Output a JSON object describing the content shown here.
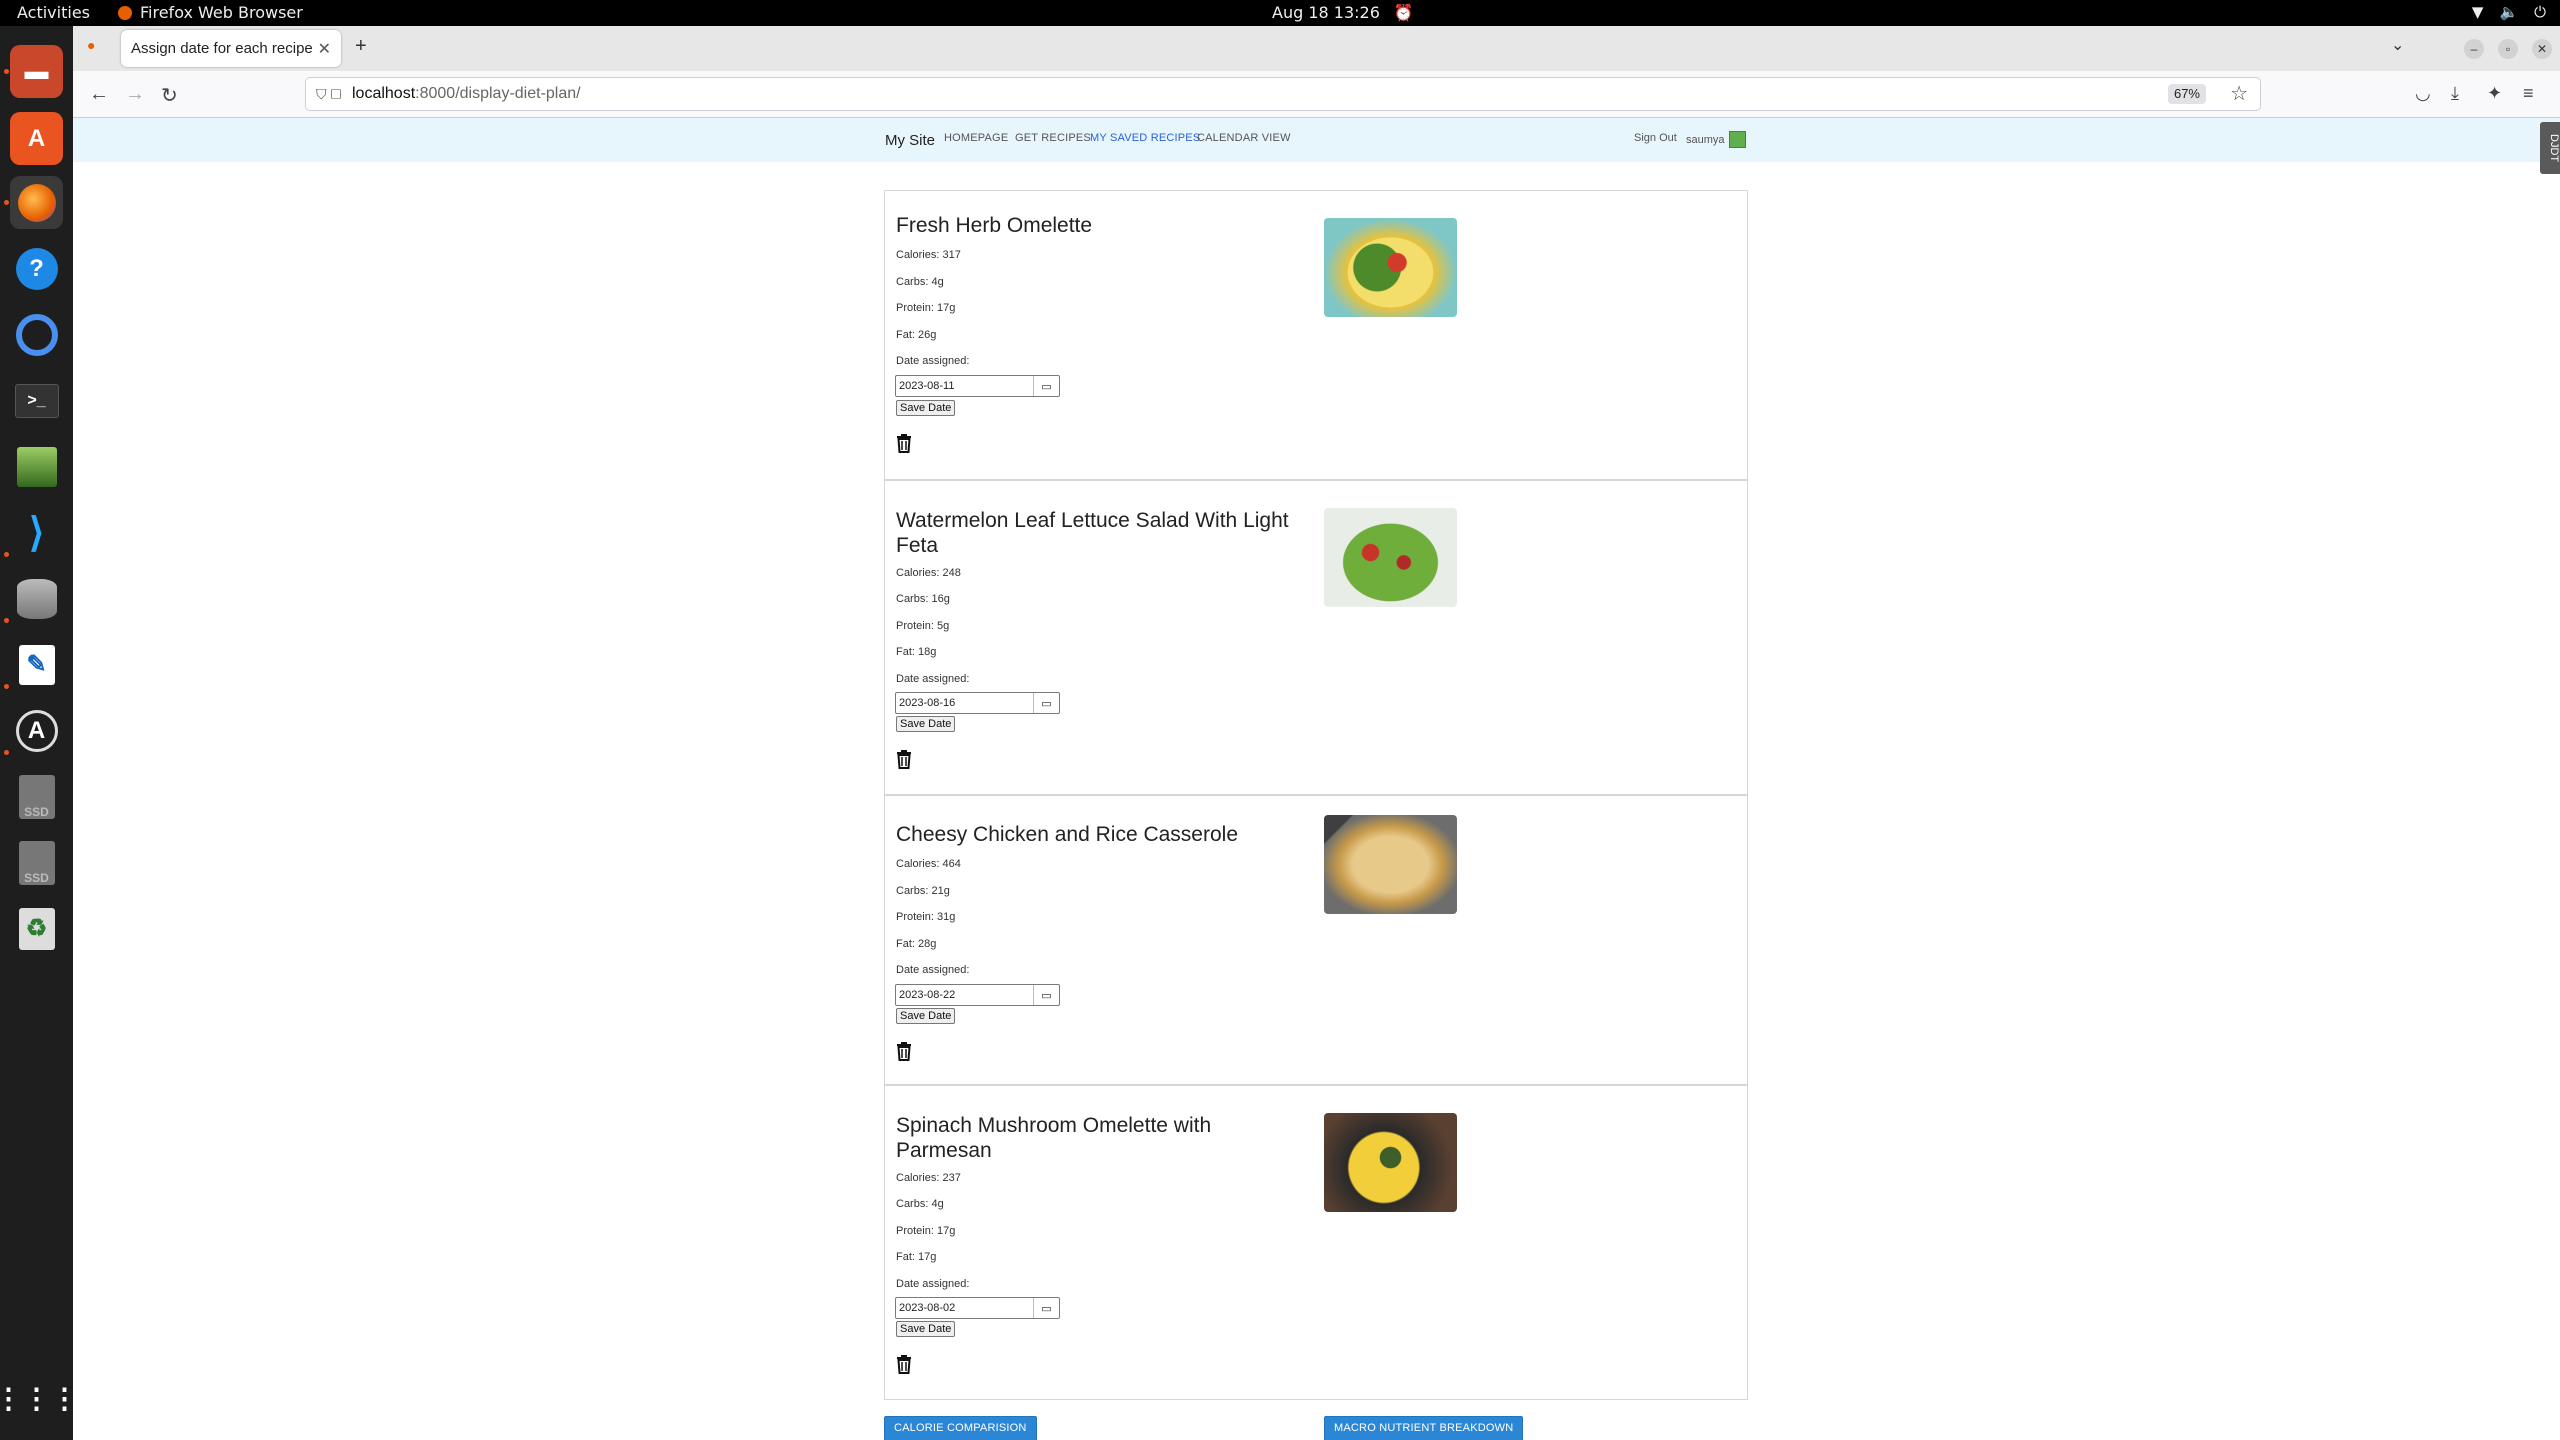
{
  "system": {
    "activities": "Activities",
    "app_name": "Firefox Web Browser",
    "clock": "Aug 18  13:26"
  },
  "browser": {
    "tab_title": "Assign date for each recipe",
    "url_host": "localhost",
    "url_path": ":8000/display-diet-plan/",
    "zoom": "67%"
  },
  "site": {
    "brand": "My Site",
    "nav": [
      "HOMEPAGE",
      "GET RECIPES",
      "MY SAVED RECIPES",
      "CALENDAR VIEW"
    ],
    "active_nav_index": 2,
    "sign_out": "Sign Out",
    "username": "saumya",
    "side_tab": "DJDT"
  },
  "recipes": [
    {
      "title": "Fresh Herb Omelette",
      "calories": "Calories: 317",
      "carbs": "Carbs: 4g",
      "protein": "Protein: 17g",
      "fat": "Fat: 26g",
      "date_label": "Date assigned:",
      "date": "2023-08-11",
      "save_label": "Save Date"
    },
    {
      "title": "Watermelon Leaf Lettuce Salad With Light Feta",
      "calories": "Calories: 248",
      "carbs": "Carbs: 16g",
      "protein": "Protein: 5g",
      "fat": "Fat: 18g",
      "date_label": "Date assigned:",
      "date": "2023-08-16",
      "save_label": "Save Date"
    },
    {
      "title": "Cheesy Chicken and Rice Casserole",
      "calories": "Calories: 464",
      "carbs": "Carbs: 21g",
      "protein": "Protein: 31g",
      "fat": "Fat: 28g",
      "date_label": "Date assigned:",
      "date": "2023-08-22",
      "save_label": "Save Date"
    },
    {
      "title": "Spinach Mushroom Omelette with Parmesan",
      "calories": "Calories: 237",
      "carbs": "Carbs: 4g",
      "protein": "Protein: 17g",
      "fat": "Fat: 17g",
      "date_label": "Date assigned:",
      "date": "2023-08-02",
      "save_label": "Save Date"
    }
  ],
  "buttons": {
    "calorie": "CALORIE COMPARISION",
    "macro": "MACRO NUTRIENT BREAKDOWN"
  },
  "colors": {
    "accent_button": "#2b86d6",
    "active_nav": "#2a62d9",
    "site_nav_bg": "#e7f5fc"
  }
}
